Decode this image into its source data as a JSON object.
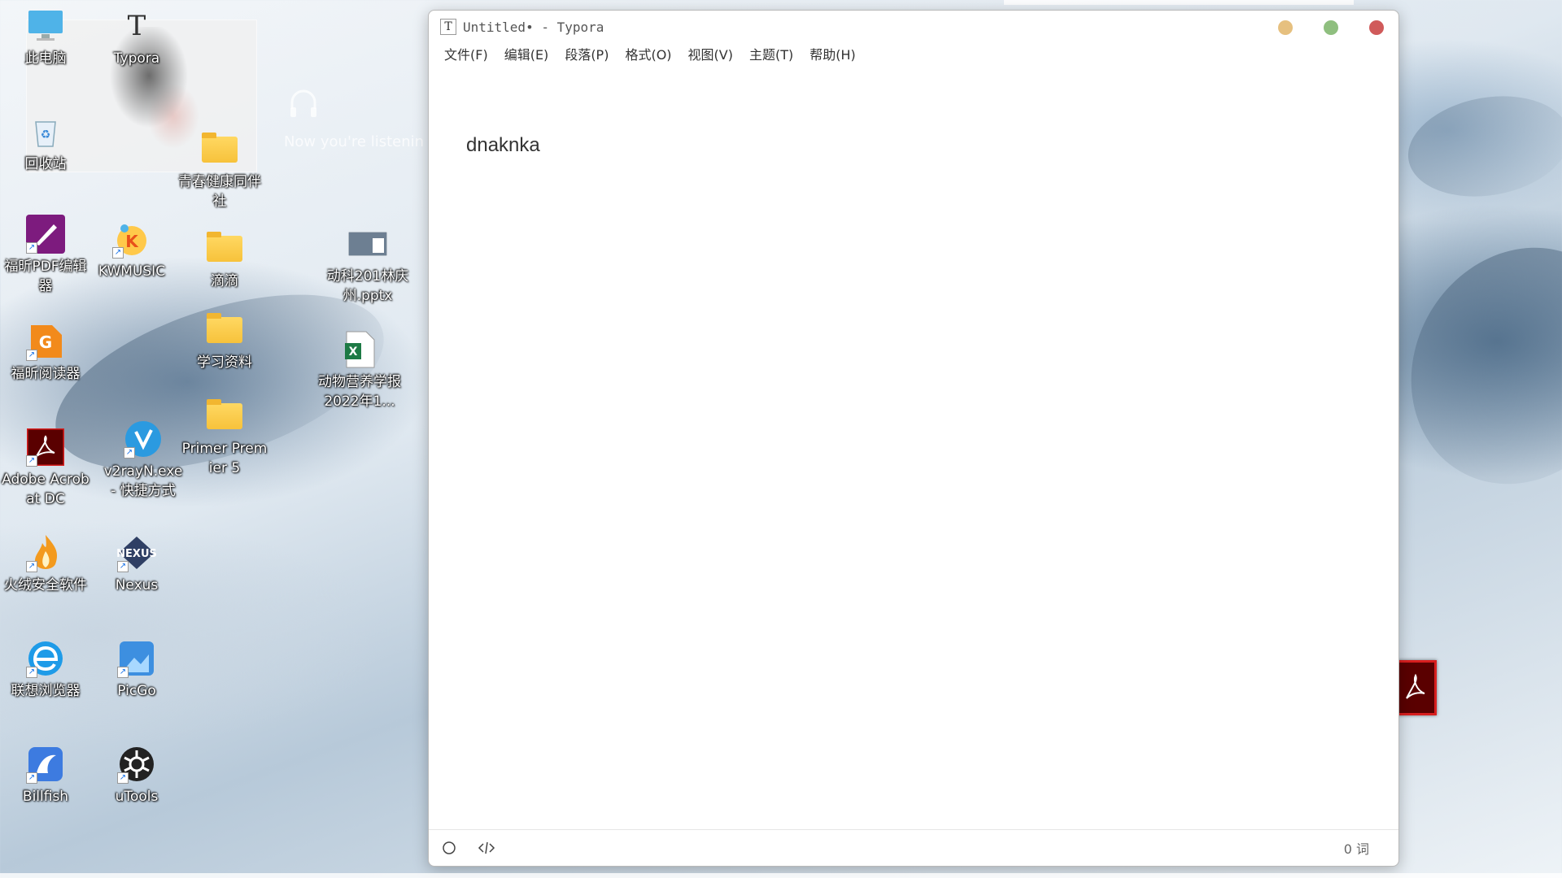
{
  "desktop": {
    "icons": [
      {
        "label": "此电脑"
      },
      {
        "label": "Typora"
      },
      {
        "label": "回收站"
      },
      {
        "label": "青春健康同伴社"
      },
      {
        "label": "福昕PDF编辑器"
      },
      {
        "label": "KWMUSIC"
      },
      {
        "label": "滴滴"
      },
      {
        "label": "动科201林庆州.pptx"
      },
      {
        "label": "学习资料"
      },
      {
        "label": "福昕阅读器"
      },
      {
        "label": "动物营养学报2022年1..."
      },
      {
        "label": "Adobe Acrobat DC"
      },
      {
        "label": "v2rayN.exe - 快捷方式"
      },
      {
        "label": "Primer Premier 5"
      },
      {
        "label": "火绒安全软件"
      },
      {
        "label": "Nexus"
      },
      {
        "label": "联想浏览器"
      },
      {
        "label": "PicGo"
      },
      {
        "label": "Billfish"
      },
      {
        "label": "uTools"
      }
    ],
    "widget_text": "Now you're listenin"
  },
  "window": {
    "title": "Untitled• - Typora",
    "app_icon": "T",
    "menu": [
      "文件(F)",
      "编辑(E)",
      "段落(P)",
      "格式(O)",
      "视图(V)",
      "主题(T)",
      "帮助(H)"
    ],
    "content": "dnaknka",
    "status": {
      "word_count": "0 词"
    },
    "controls": {
      "minimize_color": "#e6c07f",
      "maximize_color": "#8fbf7f",
      "close_color": "#d05a5a"
    }
  },
  "icons": {
    "outline_toggle": "circle-icon",
    "source_toggle": "code-icon"
  }
}
